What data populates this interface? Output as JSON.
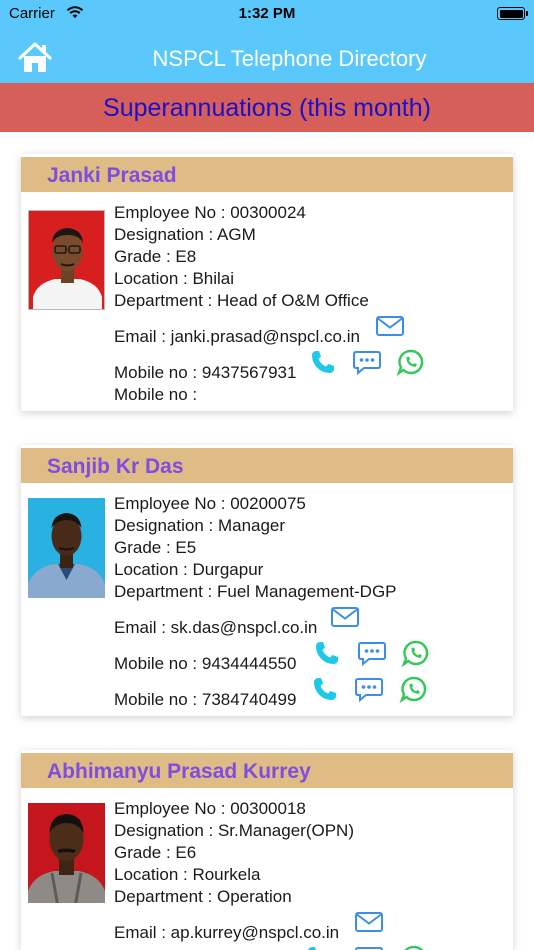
{
  "status_bar": {
    "carrier": "Carrier",
    "time": "1:32 PM"
  },
  "nav": {
    "title": "NSPCL Telephone Directory",
    "home_icon": "home-icon"
  },
  "banner": {
    "title": "Superannuations (this month)"
  },
  "colors": {
    "nav_bg": "#5ac8fa",
    "banner_bg": "#d65f5a",
    "banner_text": "#1a10c8",
    "card_header": "#dfbb86",
    "name_text": "#7e4ee0",
    "phone_icon": "#1ec9e8",
    "action_icon": "#3d8ee8",
    "whatsapp_icon": "#34c85a"
  },
  "employees": [
    {
      "name": "Janki Prasad",
      "employee_no": "Employee No : 00300024",
      "designation": "Designation : AGM",
      "grade": "Grade : E8",
      "location": "Location : Bhilai",
      "department": "Department : Head of O&M Office",
      "email": "Email : janki.prasad@nspcl.co.in",
      "mobile1": "Mobile no : 9437567931",
      "mobile2": "Mobile no :"
    },
    {
      "name": "Sanjib Kr Das",
      "employee_no": "Employee No : 00200075",
      "designation": "Designation : Manager",
      "grade": "Grade : E5",
      "location": "Location : Durgapur",
      "department": "Department : Fuel Management-DGP",
      "email": "Email : sk.das@nspcl.co.in",
      "mobile1": "Mobile no : 9434444550",
      "mobile2": "Mobile no : 7384740499"
    },
    {
      "name": "Abhimanyu Prasad Kurrey",
      "employee_no": "Employee No : 00300018",
      "designation": "Designation : Sr.Manager(OPN)",
      "grade": "Grade : E6",
      "location": "Location : Rourkela",
      "department": "Department : Operation",
      "email": "Email : ap.kurrey@nspcl.co.in"
    }
  ]
}
